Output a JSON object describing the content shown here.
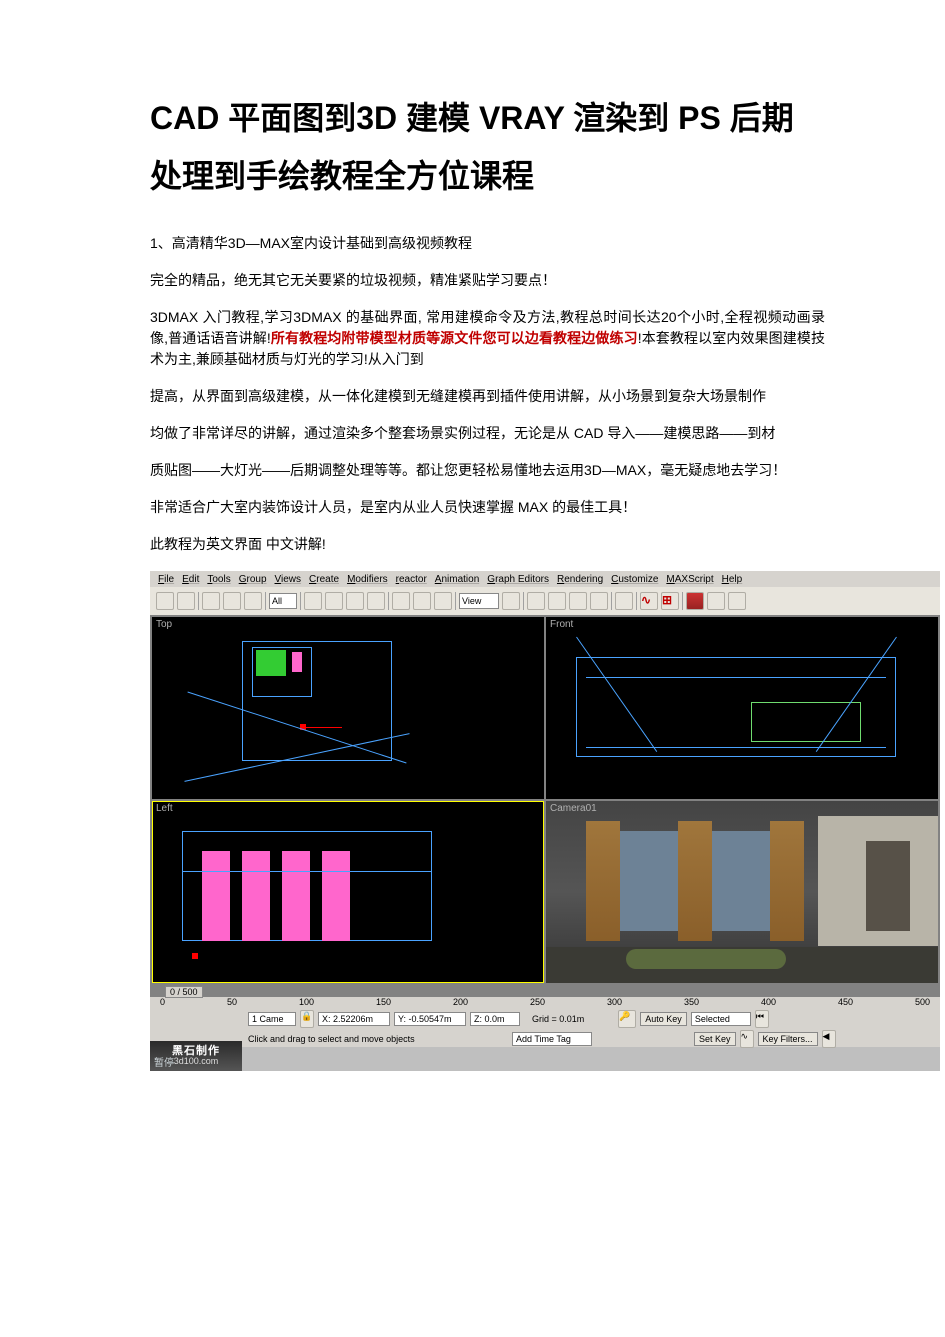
{
  "title": {
    "p1": "CAD",
    "p2": " 平面图到",
    "p3": "3D",
    "p4": " 建模 ",
    "p5": "VRAY",
    "p6": " 渲染到 ",
    "p7": "PS",
    "p8": " 后期处理到手绘教程全方位课程"
  },
  "para1": "1、高清精华3D—MAX室内设计基础到高级视频教程",
  "para2": "完全的精品，绝无其它无关要紧的垃圾视频，精准紧贴学习要点！",
  "para3_a": "3DMAX 入门教程,学习3DMAX 的基础界面, 常用建模命令及方法,教程总时间长达20个小时,全程视频动画录像,普通话语音讲解!",
  "para3_hi": "所有教程均附带模型材质等源文件您可以边看教程边做练习",
  "para3_b": "!本套教程以室内效果图建模技术为主,兼顾基础材质与灯光的学习!从入门到",
  "para4": "提高，从界面到高级建模，从一体化建模到无缝建模再到插件使用讲解，从小场景到复杂大场景制作",
  "para5": "均做了非常详尽的讲解，通过渲染多个整套场景实例过程，无论是从 CAD 导入——建模思路——到材",
  "para6": "质贴图——大灯光——后期调整处理等等。都让您更轻松易懂地去运用3D—MAX，毫无疑虑地去学习！",
  "para7": "非常适合广大室内装饰设计人员，是室内从业人员快速掌握 MAX 的最佳工具！",
  "para8": "此教程为英文界面 中文讲解!",
  "screenshot": {
    "menubar": [
      "File",
      "Edit",
      "Tools",
      "Group",
      "Views",
      "Create",
      "Modifiers",
      "reactor",
      "Animation",
      "Graph Editors",
      "Rendering",
      "Customize",
      "MAXScript",
      "Help"
    ],
    "view_dropdown": "View",
    "viewports": {
      "top": "Top",
      "front": "Front",
      "left": "Left",
      "camera": "Camera01"
    },
    "timeline": {
      "frame_indicator": "0 / 500",
      "ticks": [
        "0",
        "50",
        "100",
        "150",
        "200",
        "250",
        "300",
        "350",
        "400",
        "450",
        "500"
      ]
    },
    "status": {
      "selection": "1 Came",
      "x": "X: 2.52206m",
      "y": "Y: -0.50547m",
      "z": "Z: 0.0m",
      "grid": "Grid = 0.01m",
      "hint": "Click and drag to select and move objects",
      "add_time_tag": "Add Time Tag",
      "auto_key": "Auto Key",
      "set_key": "Set Key",
      "selected": "Selected",
      "key_filters": "Key Filters..."
    },
    "watermark": {
      "line1": "黑石制作",
      "line2": "3d100.com"
    },
    "pause": "暂停"
  }
}
